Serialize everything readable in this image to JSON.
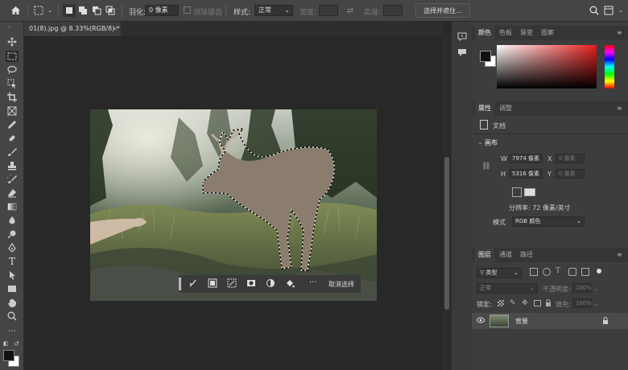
{
  "options_bar": {
    "feather_label": "羽化:",
    "feather_value": "0 像素",
    "antialias_label": "消除锯齿",
    "style_label": "样式:",
    "style_value": "正常",
    "width_label": "宽度:",
    "height_label": "高度:",
    "select_mask_button": "选择并遮住..."
  },
  "document": {
    "tab_title": "01(8).jpg @ 8.33%(RGB/8) *",
    "tab_close": "×"
  },
  "context_bar": {
    "cancel_label": "取消选择"
  },
  "color_panel": {
    "tabs": [
      "颜色",
      "色板",
      "渐变",
      "图案"
    ],
    "foreground": "#111111",
    "background": "#ffffff"
  },
  "properties_panel": {
    "tabs": [
      "属性",
      "调整"
    ],
    "doc_label": "文档",
    "canvas_section": "画布",
    "w_label": "W",
    "w_value": "7974 像素",
    "h_label": "H",
    "h_value": "5316 像素",
    "x_label": "X",
    "x_value": "0 像素",
    "y_label": "Y",
    "y_value": "0 像素",
    "resolution": "分辨率: 72 像素/英寸",
    "mode_label": "模式",
    "mode_value": "RGB 颜色"
  },
  "layers_panel": {
    "tabs": [
      "图层",
      "通道",
      "路径"
    ],
    "filter_value": "类型",
    "blend_mode": "正常",
    "opacity_label": "不透明度:",
    "opacity_value": "100%",
    "lock_label": "锁定:",
    "fill_label": "填充:",
    "fill_value": "100%",
    "layers": [
      {
        "name": "背景",
        "visible": true,
        "locked": true
      }
    ]
  }
}
